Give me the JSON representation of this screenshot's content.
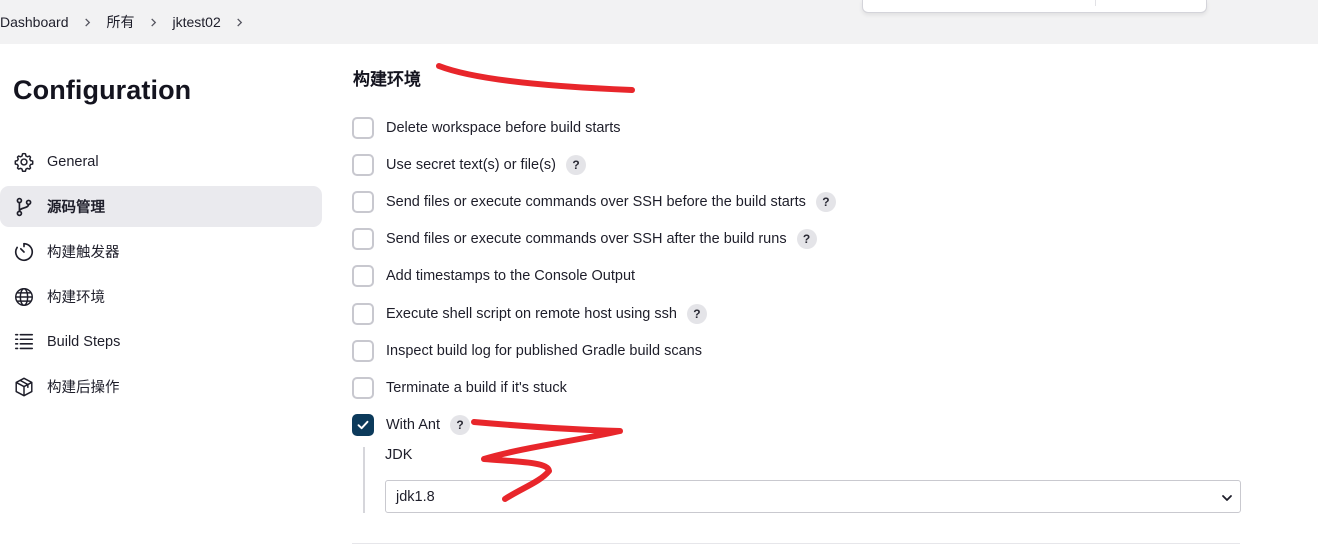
{
  "breadcrumb": {
    "items": [
      "Dashboard",
      "所有",
      "jktest02"
    ]
  },
  "sidebar": {
    "title": "Configuration",
    "items": [
      {
        "label": "General",
        "icon": "gear-icon"
      },
      {
        "label": "源码管理",
        "icon": "branch-icon",
        "active": true
      },
      {
        "label": "构建触发器",
        "icon": "timer-icon"
      },
      {
        "label": "构建环境",
        "icon": "globe-icon"
      },
      {
        "label": "Build Steps",
        "icon": "list-icon"
      },
      {
        "label": "构建后操作",
        "icon": "package-icon"
      }
    ]
  },
  "main": {
    "section_title": "构建环境",
    "options": [
      {
        "label": "Delete workspace before build starts",
        "help": false,
        "checked": false
      },
      {
        "label": "Use secret text(s) or file(s)",
        "help": true,
        "checked": false
      },
      {
        "label": "Send files or execute commands over SSH before the build starts",
        "help": true,
        "checked": false
      },
      {
        "label": "Send files or execute commands over SSH after the build runs",
        "help": true,
        "checked": false
      },
      {
        "label": "Add timestamps to the Console Output",
        "help": false,
        "checked": false
      },
      {
        "label": "Execute shell script on remote host using ssh",
        "help": true,
        "checked": false
      },
      {
        "label": "Inspect build log for published Gradle build scans",
        "help": false,
        "checked": false
      },
      {
        "label": "Terminate a build if it's stuck",
        "help": false,
        "checked": false
      },
      {
        "label": "With Ant",
        "help": true,
        "checked": true
      }
    ],
    "help_glyph": "?",
    "jdk": {
      "label": "JDK",
      "selected": "jdk1.8"
    }
  },
  "colors": {
    "accent": "#0c3a5b",
    "breadcrumb_bg": "#f2f2f3",
    "annotation": "#e8262b"
  }
}
